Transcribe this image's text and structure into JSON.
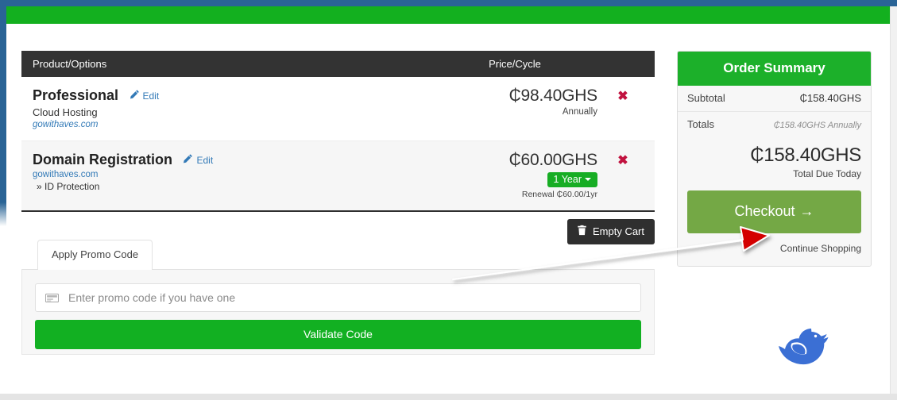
{
  "window": {
    "chrome_color": "#2a6496",
    "topbar_color": "#13b01f"
  },
  "cart": {
    "header": {
      "product_column": "Product/Options",
      "price_column": "Price/Cycle"
    },
    "rows": [
      {
        "name": "Professional",
        "edit_label": "Edit",
        "edit_icon": "pencil-icon",
        "subtitle": "Cloud Hosting",
        "domain": "gowithaves.com",
        "price": "₵98.40GHS",
        "cycle": "Annually",
        "remove_icon": "x-remove-icon"
      },
      {
        "name": "Domain Registration",
        "edit_label": "Edit",
        "edit_icon": "pencil-icon",
        "domain": "gowithaves.com",
        "addon": "» ID Protection",
        "price": "₵60.00GHS",
        "term_badge": "1 Year",
        "renewal": "Renewal ₵60.00/1yr",
        "remove_icon": "x-remove-icon"
      }
    ],
    "empty_cart_label": "Empty Cart",
    "empty_cart_icon": "trash-icon"
  },
  "promo": {
    "tab_label": "Apply Promo Code",
    "input_value": "",
    "placeholder": "Enter promo code if you have one",
    "input_icon": "ticket-icon",
    "validate_label": "Validate Code",
    "validate_color": "#12b022"
  },
  "summary": {
    "title": "Order Summary",
    "title_bg": "#1cb02a",
    "rows": [
      {
        "label": "Subtotal",
        "value": "₵158.40GHS",
        "muted": false
      },
      {
        "label": "Totals",
        "value": "₵158.40GHS Annually",
        "muted": true
      }
    ],
    "total_amount": "₵158.40GHS",
    "total_label": "Total Due Today",
    "checkout_label": "Checkout",
    "checkout_arrow": "→",
    "checkout_color": "#74a845",
    "continue_label": "Continue Shopping"
  },
  "branding": {
    "logo_icon": "blue-bird-logo",
    "logo_color": "#3b6fd4"
  },
  "annotation": {
    "arrow_color": "#d40000",
    "target": "checkout-button"
  }
}
